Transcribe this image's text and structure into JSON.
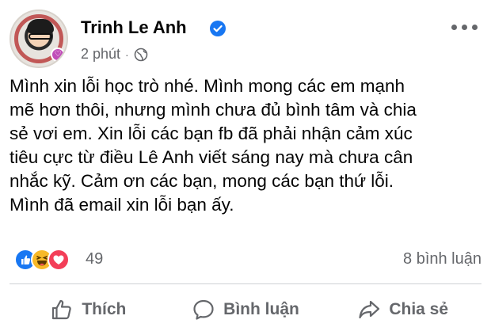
{
  "post": {
    "author": "Trinh Le Anh",
    "verified": true,
    "timestamp": "2 phút",
    "separator": "·",
    "audience_icon": "globe-icon",
    "message_lines": [
      "Mình xin lỗi học trò nhé. Mình mong các em mạnh",
      "mẽ hơn thôi, nhưng mình chưa đủ bình tâm và chia",
      "sẻ vơi em. Xin lỗi các bạn fb đã phải nhận cảm xúc",
      "tiêu cực từ điều Lê Anh viết sáng nay mà chưa cân",
      "nhắc kỹ. Cảm ơn các bạn, mong các bạn thứ lỗi.",
      "Mình đã email xin lỗi bạn ấy."
    ]
  },
  "stats": {
    "reaction_icons": [
      "like-icon",
      "haha-icon",
      "love-icon"
    ],
    "reaction_count": "49",
    "comments": "8 bình luận"
  },
  "actions": {
    "like": "Thích",
    "comment": "Bình luận",
    "share": "Chia sẻ"
  },
  "colors": {
    "text": "#050505",
    "secondary": "#65676b",
    "verified_blue": "#1877f2",
    "like_blue": "#1877f2",
    "haha_yellow": "#f7b928",
    "love_red": "#f33e58",
    "divider": "#ced0d4"
  }
}
